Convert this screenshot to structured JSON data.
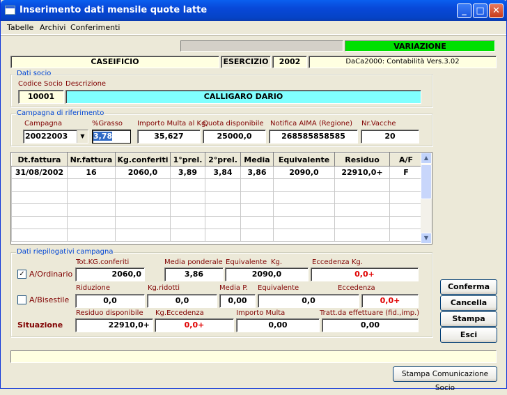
{
  "window": {
    "title": "Inserimento dati mensile quote latte",
    "min": "_",
    "max": "□",
    "close": "✕"
  },
  "menu": [
    "Tabelle",
    "Archivi",
    "Conferimenti"
  ],
  "top": {
    "mode": "VARIAZIONE",
    "caseificio": "CASEIFICIO",
    "esercizio_label": "ESERCIZIO",
    "esercizio": "2002",
    "version": "DaCa2000: Contabilità Vers.3.02"
  },
  "socio": {
    "group": "Dati socio",
    "codice_label": "Codice Socio",
    "descr_label": "Descrizione",
    "codice": "10001",
    "descrizione": "CALLIGARO DARIO"
  },
  "campagna": {
    "group": "Campagna di riferimento",
    "labels": [
      "Campagna",
      "%Grasso",
      "Importo Multa al Kg.",
      "Quota disponibile",
      "Notifica AIMA (Regione)",
      "Nr.Vacche"
    ],
    "campagna": "20022003",
    "grasso": "3,78",
    "multa": "35,627",
    "quota": "25000,0",
    "notifica": "268585858585",
    "vacche": "20"
  },
  "grid": {
    "headers": [
      "Dt.fattura",
      "Nr.fattura",
      "Kg.conferiti",
      "1°prel.",
      "2°prel.",
      "Media",
      "Equivalente",
      "Residuo",
      "A/F"
    ],
    "rows": [
      [
        "31/08/2002",
        "16",
        "2060,0",
        "3,89",
        "3,84",
        "3,86",
        "2090,0",
        "22910,0+",
        "F"
      ]
    ]
  },
  "riepilogo": {
    "group": "Dati riepilogativi campagna",
    "ordinario": {
      "label": "A/Ordinario",
      "checked": "✓",
      "l1": "Tot.KG.conferiti",
      "l2": "Media ponderale",
      "l3": "Equivalente",
      "l3b": "Kg.",
      "l4": "Eccedenza Kg.",
      "v1": "2060,0",
      "v2": "3,86",
      "v3": "2090,0",
      "v4": "0,0+"
    },
    "bisestile": {
      "label": "A/Bisestile",
      "checked": "",
      "l1": "Riduzione",
      "l2": "Kg.ridotti",
      "l3": "Media P.",
      "l4": "Equivalente",
      "l5": "Eccedenza",
      "v1": "0,0",
      "v2": "0,0",
      "v3": "0,00",
      "v4": "0,0",
      "v5": "0,0+"
    },
    "situazione": {
      "label": "Situazione",
      "l1": "Residuo disponibile",
      "l2": "Kg.Eccedenza",
      "l3": "Importo Multa",
      "l4": "Tratt.da effettuare (fid.,imp.)",
      "v1": "22910,0+",
      "v2": "0,0+",
      "v3": "0,00",
      "v4": "0,00"
    }
  },
  "buttons": {
    "conferma": "Conferma",
    "cancella": "Cancella",
    "stampa": "Stampa",
    "esci": "Esci",
    "stampa_com": "Stampa Comunicazione Socio"
  }
}
